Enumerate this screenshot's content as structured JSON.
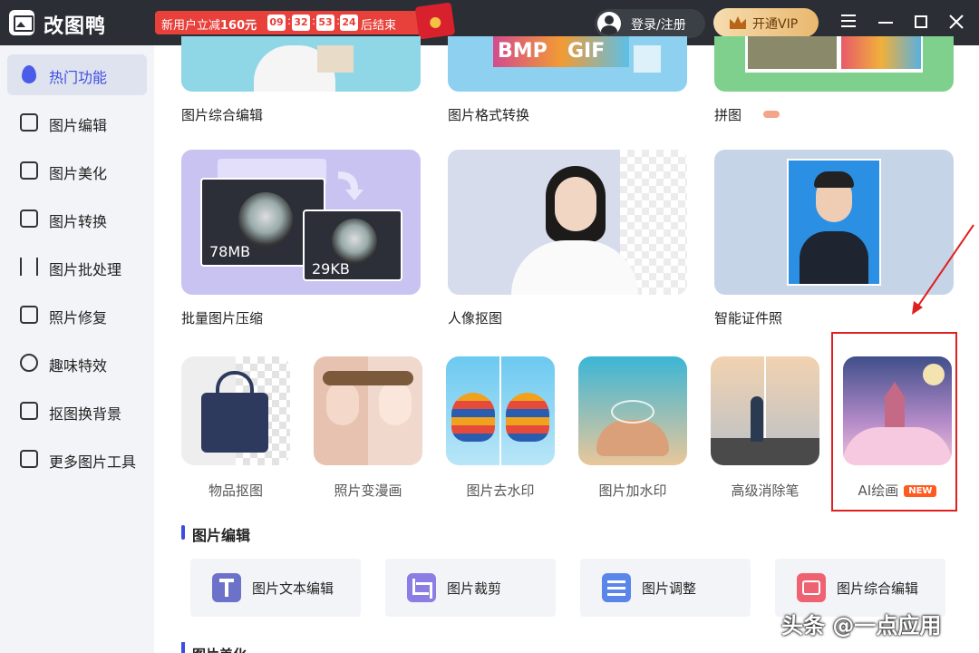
{
  "app": {
    "name": "改图鸭"
  },
  "promo": {
    "prefix": "新用户立减",
    "amount": "160元",
    "countdown": [
      "09",
      "32",
      "53",
      "24"
    ],
    "suffix": "后结束"
  },
  "header": {
    "login_label": "登录/注册",
    "vip_label": "开通VIP"
  },
  "sidebar": {
    "items": [
      {
        "label": "热门功能",
        "active": true
      },
      {
        "label": "图片编辑"
      },
      {
        "label": "图片美化"
      },
      {
        "label": "图片转换"
      },
      {
        "label": "图片批处理"
      },
      {
        "label": "照片修复"
      },
      {
        "label": "趣味特效"
      },
      {
        "label": "抠图换背景"
      },
      {
        "label": "更多图片工具"
      }
    ]
  },
  "top_cards": [
    {
      "label": "图片综合编辑"
    },
    {
      "label": "图片格式转换",
      "formats": [
        "BMP",
        "GIF"
      ]
    },
    {
      "label": "拼图"
    }
  ],
  "big_cards": [
    {
      "label": "批量图片压缩",
      "size_before": "78MB",
      "size_after": "29KB"
    },
    {
      "label": "人像抠图"
    },
    {
      "label": "智能证件照"
    }
  ],
  "tiles": [
    {
      "label": "物品抠图"
    },
    {
      "label": "照片变漫画"
    },
    {
      "label": "图片去水印"
    },
    {
      "label": "图片加水印"
    },
    {
      "label": "高级消除笔"
    },
    {
      "label": "AI绘画",
      "badge": "NEW"
    }
  ],
  "sections": {
    "edit_title": "图片编辑",
    "next_title": "图片美化"
  },
  "tools": [
    {
      "label": "图片文本编辑",
      "icon": "text-edit-icon",
      "color": "#5b63c8"
    },
    {
      "label": "图片裁剪",
      "icon": "crop-icon",
      "color": "#7b6de0"
    },
    {
      "label": "图片调整",
      "icon": "adjust-icon",
      "color": "#4f7be6"
    },
    {
      "label": "图片综合编辑",
      "icon": "image-edit-icon",
      "color": "#ef5a6a"
    }
  ],
  "watermark": "头条 @一点应用"
}
